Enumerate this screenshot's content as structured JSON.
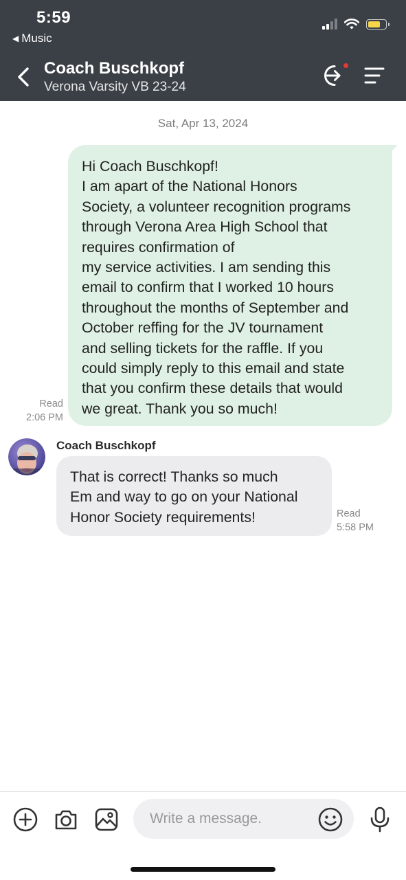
{
  "status_bar": {
    "time": "5:59",
    "back_app": "Music"
  },
  "header": {
    "name": "Coach Buschkopf",
    "subtitle": "Verona Varsity VB 23-24"
  },
  "conversation": {
    "date": "Sat, Apr 13, 2024",
    "messages": [
      {
        "direction": "outgoing",
        "text": "Hi Coach Buschkopf!\nI am apart of the National Honors\nSociety, a volunteer recognition programs\nthrough Verona Area High School that\nrequires confirmation of\nmy service activities. I am sending this\nemail to confirm that I worked 10 hours\nthroughout the months of September and\nOctober reffing for the JV tournament\nand selling tickets for the raffle. If you\ncould simply reply to this email and state\nthat you confirm these details that would\nwe great. Thank you so much!",
        "status": "Read",
        "time": "2:06 PM"
      },
      {
        "direction": "incoming",
        "sender": "Coach Buschkopf",
        "text": "That is correct! Thanks so much\nEm and way to go on your National\nHonor Society requirements!",
        "status": "Read",
        "time": "5:58 PM"
      }
    ]
  },
  "composer": {
    "placeholder": "Write a message."
  },
  "colors": {
    "header_bg": "#3b4047",
    "outgoing_bubble": "#dff1e4",
    "incoming_bubble": "#ececee",
    "notification_dot": "#e53935"
  },
  "icons": [
    "back-triangle-icon",
    "cellular-signal-icon",
    "wifi-icon",
    "battery-icon",
    "chevron-left-icon",
    "exit-icon",
    "menu-icon",
    "add-icon",
    "camera-icon",
    "image-icon",
    "emoji-icon",
    "microphone-icon"
  ]
}
